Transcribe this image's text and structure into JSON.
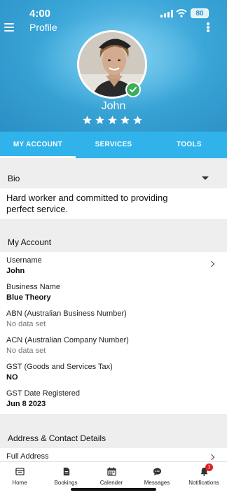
{
  "status_bar": {
    "time": "4:00",
    "battery": "80"
  },
  "header": {
    "title": "Profile"
  },
  "profile": {
    "name": "John",
    "rating": 5
  },
  "tabs": [
    {
      "label": "MY ACCOUNT",
      "active": true
    },
    {
      "label": "SERVICES",
      "active": false
    },
    {
      "label": "TOOLS",
      "active": false
    }
  ],
  "bio": {
    "title": "Bio",
    "text": "Hard worker and committed to providing perfect service."
  },
  "my_account": {
    "title": "My Account",
    "fields": [
      {
        "label": "Username",
        "value": "John"
      },
      {
        "label": "Business Name",
        "value": "Blue Theory"
      },
      {
        "label": "ABN (Australian Business Number)",
        "value": "No data set"
      },
      {
        "label": "ACN (Australian Company Number)",
        "value": "No data set"
      },
      {
        "label": "GST (Goods and Services Tax)",
        "value": "NO"
      },
      {
        "label": "GST Date Registered",
        "value": "Jun 8 2023"
      }
    ]
  },
  "address": {
    "title": "Address & Contact Details",
    "first_item": "Full Address"
  },
  "bottom_nav": [
    {
      "label": "Home",
      "icon": "home-icon"
    },
    {
      "label": "Bookings",
      "icon": "document-icon"
    },
    {
      "label": "Calender",
      "icon": "calendar-icon"
    },
    {
      "label": "Messages",
      "icon": "chat-icon"
    },
    {
      "label": "Notifications",
      "icon": "bell-icon",
      "badge": "1"
    }
  ],
  "colors": {
    "header_bg": "#3aa6d8",
    "tab_bar": "#2fb3ea",
    "verified": "#3dae57",
    "badge": "#e02020"
  }
}
